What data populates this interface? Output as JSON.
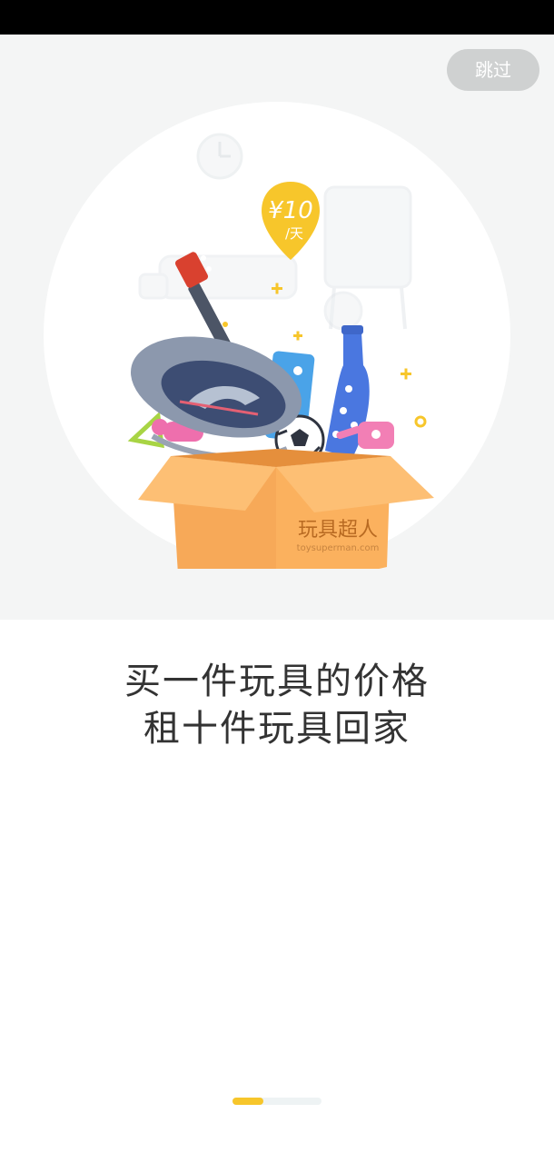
{
  "skip_button": {
    "label": "跳过"
  },
  "price_tag": {
    "price": "¥10",
    "unit": "/天"
  },
  "box_brand": {
    "name": "玩具超人",
    "url": "toysuperman.com"
  },
  "headline": {
    "line1": "买一件玩具的价格",
    "line2": "租十件玩具回家"
  },
  "pager": {
    "total_pages": 3,
    "current_page": 1
  },
  "colors": {
    "accent": "#f7c62b",
    "box": "#fbb15e",
    "skip_bg": "#cfd1d1",
    "hero_bg": "#f4f5f5"
  }
}
